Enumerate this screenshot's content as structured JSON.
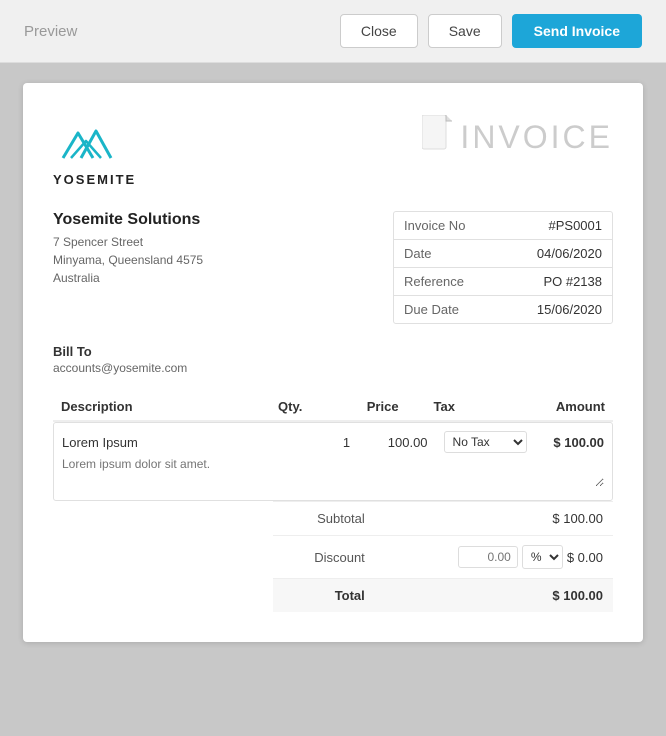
{
  "topbar": {
    "title": "Preview",
    "close_label": "Close",
    "save_label": "Save",
    "send_label": "Send Invoice"
  },
  "invoice": {
    "company": {
      "logo_name": "YOSEMITE",
      "name": "Yosemite Solutions",
      "address1": "7 Spencer Street",
      "address2": "Minyama, Queensland 4575",
      "address3": "Australia"
    },
    "label": "INVOICE",
    "meta": {
      "invoice_no_label": "Invoice No",
      "invoice_no_value": "#PS0001",
      "date_label": "Date",
      "date_value": "04/06/2020",
      "reference_label": "Reference",
      "reference_value": "PO #2138",
      "due_date_label": "Due Date",
      "due_date_value": "15/06/2020"
    },
    "bill_to": {
      "label": "Bill To",
      "email": "accounts@yosemite.com"
    },
    "table": {
      "headers": {
        "description": "Description",
        "qty": "Qty.",
        "price": "Price",
        "tax": "Tax",
        "amount": "Amount"
      },
      "items": [
        {
          "description": "Lorem Ipsum",
          "desc_note": "Lorem ipsum dolor sit amet.",
          "qty": "1",
          "price": "100.00",
          "tax": "No Tax",
          "amount": "$ 100.00"
        }
      ]
    },
    "totals": {
      "subtotal_label": "Subtotal",
      "subtotal_value": "$ 100.00",
      "discount_label": "Discount",
      "discount_input_placeholder": "0.00",
      "discount_type": "%",
      "discount_value": "$ 0.00",
      "total_label": "Total",
      "total_value": "$ 100.00"
    }
  }
}
